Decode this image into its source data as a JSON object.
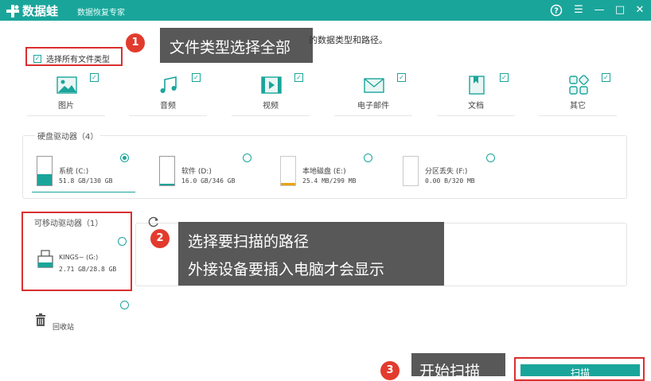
{
  "titlebar": {
    "app_name": "数据蛙",
    "subtitle": "数据恢复专家",
    "help_glyph": "?",
    "menu_glyph": "☰",
    "min_glyph": "—",
    "max_glyph": "□",
    "close_glyph": "✕"
  },
  "hint_text": "的数据类型和路径。",
  "select_all": {
    "label": "选择所有文件类型",
    "checked": true
  },
  "file_types": [
    {
      "label": "图片",
      "icon": "picture-icon",
      "checked": true
    },
    {
      "label": "音频",
      "icon": "audio-icon",
      "checked": true
    },
    {
      "label": "视频",
      "icon": "video-icon",
      "checked": true
    },
    {
      "label": "电子邮件",
      "icon": "email-icon",
      "checked": true
    },
    {
      "label": "文档",
      "icon": "document-icon",
      "checked": true
    },
    {
      "label": "其它",
      "icon": "other-icon",
      "checked": true
    }
  ],
  "hard_drives": {
    "title": "硬盘驱动器（4）",
    "items": [
      {
        "name": "系统 (C:)",
        "size": "51.8 GB/130 GB",
        "fill_fraction": 0.4,
        "fill_color": "#1aa59b",
        "selected": true
      },
      {
        "name": "软件 (D:)",
        "size": "16.0 GB/346 GB",
        "fill_fraction": 0.05,
        "fill_color": "#1aa59b",
        "selected": false
      },
      {
        "name": "本地磁盘 (E:)",
        "size": "25.4 MB/299 MB",
        "fill_fraction": 0.08,
        "fill_color": "#e8a317",
        "selected": false
      },
      {
        "name": "分区丢失 (F:)",
        "size": "0.00  B/320 MB",
        "fill_fraction": 0.0,
        "fill_color": "#e8a317",
        "selected": false
      }
    ]
  },
  "removable": {
    "title": "可移动驱动器（1）",
    "item": {
      "name": "KINGS~ (G:)",
      "size": "2.71 GB/28.8 GB",
      "selected": false
    }
  },
  "recycle_bin": {
    "label": "回收站",
    "selected": false
  },
  "callouts": {
    "c1": {
      "number": "1",
      "text": "文件类型选择全部"
    },
    "c2": {
      "number": "2",
      "line1": "选择要扫描的路径",
      "line2": "外接设备要插入电脑才会显示"
    },
    "c3": {
      "number": "3",
      "text": "开始扫描"
    }
  },
  "scan_button": {
    "label": "扫描"
  },
  "colors": {
    "accent": "#1aa59b",
    "annotation_red": "#d9302f"
  }
}
